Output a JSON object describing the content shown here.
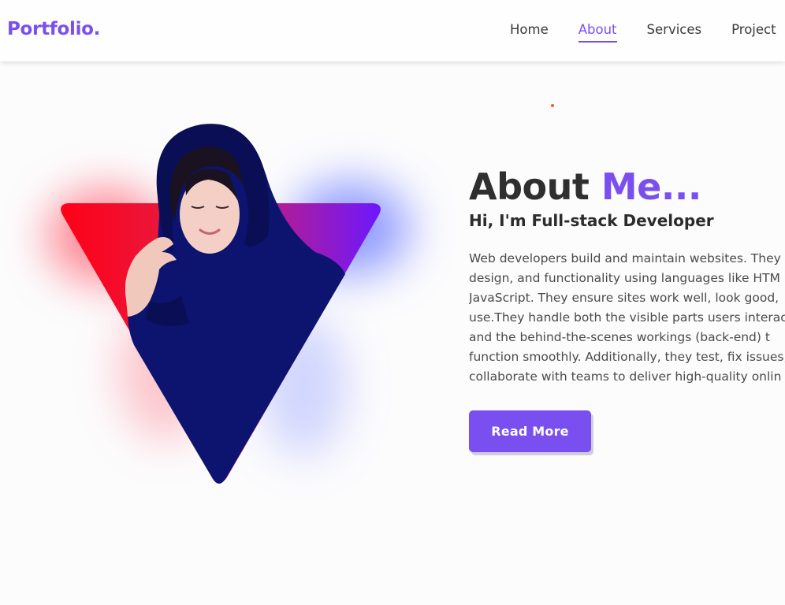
{
  "header": {
    "logo": "Portfolio.",
    "nav": [
      {
        "label": "Home",
        "active": false
      },
      {
        "label": "About",
        "active": true
      },
      {
        "label": "Services",
        "active": false
      },
      {
        "label": "Project",
        "active": false
      }
    ]
  },
  "about": {
    "title_main": "About ",
    "title_accent": "Me...",
    "subtitle": "Hi, I'm Full-stack Developer",
    "description_lines": [
      "Web developers build and maintain websites. They",
      "design, and functionality using languages like HTM",
      "JavaScript. They ensure sites work well, look good,",
      "use.They handle both the visible parts users interac",
      "and the behind-the-scenes workings (back-end) t",
      "function smoothly. Additionally, they test, fix issues,",
      "collaborate with teams to deliver high-quality onlin"
    ],
    "button_label": "Read More"
  },
  "colors": {
    "accent": "#7a4ff0",
    "triangle_left": "#ff0018",
    "triangle_right": "#7a1bff",
    "hoodie": "#0d1570"
  }
}
